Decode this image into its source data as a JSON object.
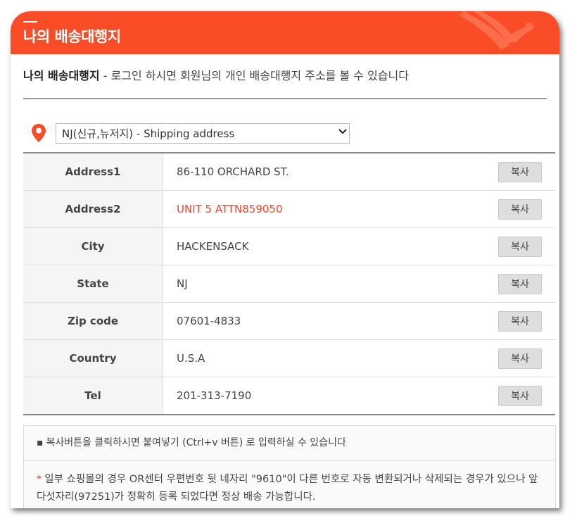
{
  "header": {
    "title": "나의 배송대행지"
  },
  "intro": {
    "title": "나의 배송대행지",
    "text": " - 로그인 하시면 회원님의 개인 배송대행지 주소를 볼 수 있습니다"
  },
  "selector": {
    "selected": "NJ(신규,뉴저지) - Shipping address",
    "icon": "location-pin-icon",
    "accent_color": "#fa4c26"
  },
  "address": {
    "copy_label": "복사",
    "rows": [
      {
        "label": "Address1",
        "value": "86-110 ORCHARD ST."
      },
      {
        "label": "Address2",
        "value": "UNIT 5 ATTN859050"
      },
      {
        "label": "City",
        "value": "HACKENSACK"
      },
      {
        "label": "State",
        "value": "NJ"
      },
      {
        "label": "Zip code",
        "value": "07601-4833"
      },
      {
        "label": "Country",
        "value": "U.S.A"
      },
      {
        "label": "Tel",
        "value": "201-313-7190"
      }
    ],
    "highlight_color": "#e8452c"
  },
  "notes": {
    "note1": "복사버튼을 클릭하시면 붙여넣기 (Ctrl+v 버튼) 로 입력하실 수 있습니다",
    "note2_star": "*",
    "note2": "일부 쇼핑몰의 경우 OR센터 우편번호 뒷 네자리 \"9610\"이 다른 번호로 자동 변환되거나 삭제되는 경우가 있으나 앞 다섯자리(97251)가 정확히 등록 되었다면 정상 배송 가능합니다."
  }
}
